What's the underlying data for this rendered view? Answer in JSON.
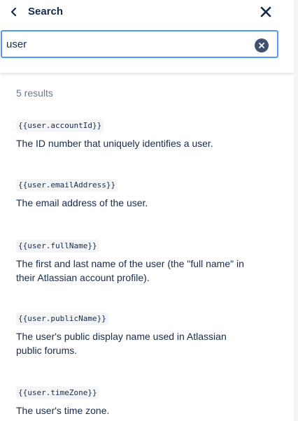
{
  "header": {
    "title": "Search",
    "back_icon": "chevron-left-icon",
    "close_icon": "close-icon"
  },
  "search": {
    "value": "user",
    "placeholder": "",
    "clear_icon": "clear-icon"
  },
  "results_count": "5 results",
  "results": [
    {
      "code": "{{user.accountId}}",
      "description": "The ID number that uniquely identifies a user."
    },
    {
      "code": "{{user.emailAddress}}",
      "description": "The email address of the user."
    },
    {
      "code": "{{user.fullName}}",
      "description": "The first and last name of the user (the \"full name\" in their Atlassian account profile)."
    },
    {
      "code": "{{user.publicName}}",
      "description": "The user's public display name used in Atlassian public forums."
    },
    {
      "code": "{{user.timeZone}}",
      "description": "The user's time zone."
    }
  ],
  "colors": {
    "focus_border": "#4c9aff",
    "text": "#172b4d",
    "muted": "#6b778c",
    "code_bg": "#f4f5f7"
  }
}
